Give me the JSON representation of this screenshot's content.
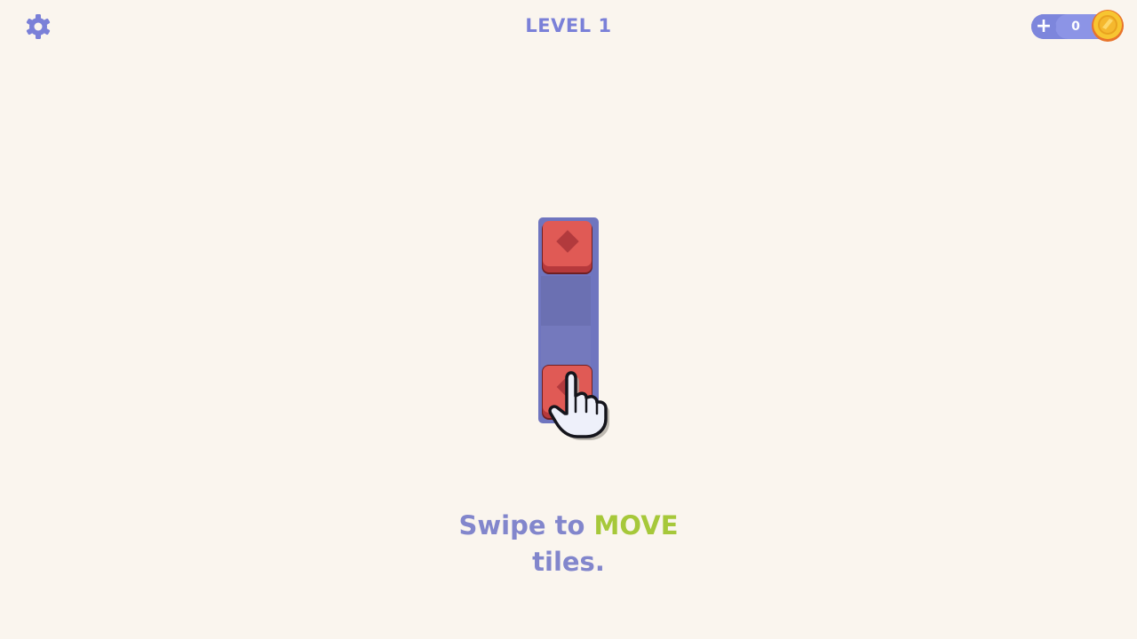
{
  "header": {
    "level_label": "LEVEL 1"
  },
  "wallet": {
    "add_label": "+",
    "coins": "0"
  },
  "board": {
    "columns": 1,
    "rows": 4,
    "tiles": [
      {
        "row": 0,
        "color": "red",
        "symbol": "diamond"
      },
      {
        "row": 3,
        "color": "red",
        "symbol": "diamond"
      }
    ]
  },
  "tutorial": {
    "line1_prefix": "Swipe to",
    "line1_highlight": "MOVE",
    "line2": "tiles."
  },
  "colors": {
    "background": "#faf5ee",
    "accent": "#7a80d8",
    "board": "#6f75bf",
    "tile": "#e05a55",
    "tile_symbol": "#b23a3d",
    "highlight": "#a6c83a",
    "coin": "#f5b82e"
  },
  "icons": {
    "settings": "gear-icon",
    "coin": "coin-icon",
    "add": "plus-icon",
    "hint": "pointing-hand-icon"
  }
}
